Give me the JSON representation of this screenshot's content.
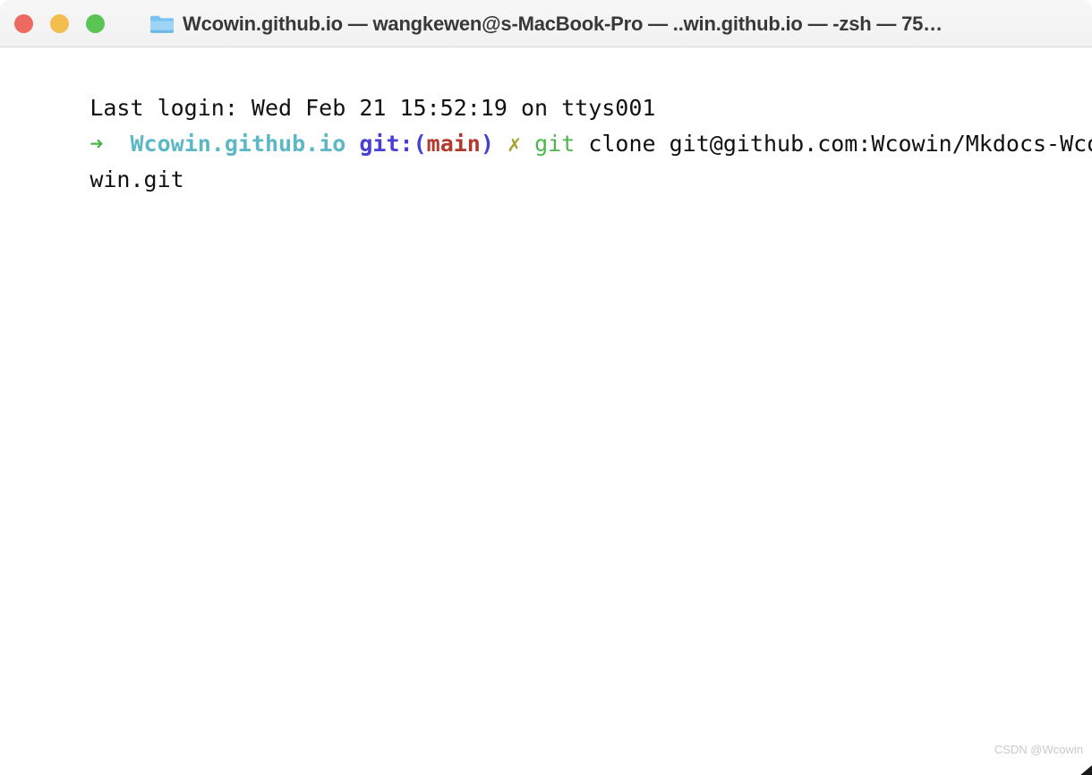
{
  "window": {
    "title": "Wcowin.github.io — wangkewen@s-MacBook-Pro — ..win.github.io — -zsh — 75…",
    "folder_icon": "folder-icon",
    "controls": {
      "close_label": "close",
      "minimize_label": "minimize",
      "maximize_label": "maximize",
      "close_color": "#ec6a5f",
      "minimize_color": "#f4bd4f",
      "maximize_color": "#5ac454"
    }
  },
  "terminal": {
    "login_line": "Last login: Wed Feb 21 15:52:19 on ttys001",
    "prompt": {
      "arrow": "➜",
      "spacer": "  ",
      "directory": "Wcowin.github.io",
      "git_prefix": "git:(",
      "branch": "main",
      "git_suffix": ")",
      "dirty_mark": "✗",
      "command_name": "git",
      "command_args": " clone git@github.com:Wcowin/Mkdocs-Wco",
      "command_wrap": "win.git"
    },
    "colors": {
      "text": "#111111",
      "arrow": "#4cb64c",
      "directory": "#5bb8c4",
      "git": "#4a3fd4",
      "branch": "#b5382c",
      "dirty": "#a8a12e",
      "command": "#4cb64c",
      "background": "#ffffff"
    }
  },
  "watermark": {
    "text": "CSDN @Wcowin"
  }
}
